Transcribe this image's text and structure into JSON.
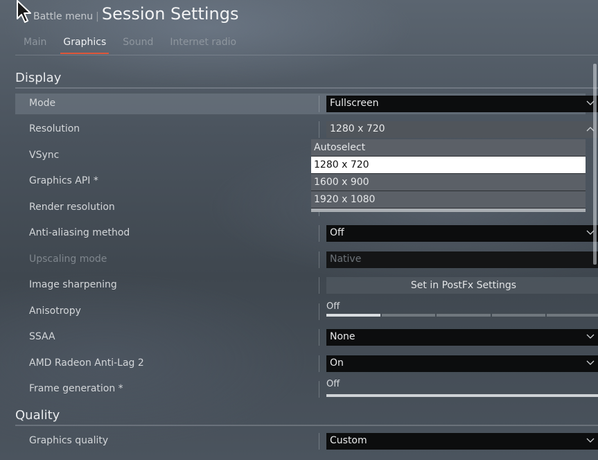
{
  "header": {
    "breadcrumb": "Battle menu",
    "separator": "|",
    "title": "Session Settings"
  },
  "tabs": [
    {
      "label": "Main",
      "active": false
    },
    {
      "label": "Graphics",
      "active": true
    },
    {
      "label": "Sound",
      "active": false
    },
    {
      "label": "Internet radio",
      "active": false
    }
  ],
  "sections": {
    "display": "Display",
    "quality": "Quality"
  },
  "settings": {
    "mode": {
      "label": "Mode",
      "value": "Fullscreen"
    },
    "resolution": {
      "label": "Resolution",
      "value": "1280 x 720",
      "options": [
        "Autoselect",
        "1280 x 720",
        "1600 x 900",
        "1920 x 1080"
      ],
      "selected_index": 1
    },
    "vsync": {
      "label": "VSync"
    },
    "graphics_api": {
      "label": "Graphics API *"
    },
    "render_resolution": {
      "label": "Render resolution"
    },
    "anti_aliasing": {
      "label": "Anti-aliasing method",
      "value": "Off"
    },
    "upscaling": {
      "label": "Upscaling mode",
      "value": "Native"
    },
    "image_sharpening": {
      "label": "Image sharpening",
      "button": "Set in PostFx Settings"
    },
    "anisotropy": {
      "label": "Anisotropy",
      "value": "Off",
      "level": 0.2
    },
    "ssaa": {
      "label": "SSAA",
      "value": "None"
    },
    "antilag": {
      "label": "AMD Radeon Anti-Lag 2",
      "value": "On"
    },
    "frame_generation": {
      "label": "Frame generation *",
      "value": "Off"
    },
    "graphics_quality": {
      "label": "Graphics quality",
      "value": "Custom"
    }
  },
  "colors": {
    "accent": "#e0573a",
    "control_bg": "#0c0d0e",
    "dropdown_selected": "#ffffff"
  }
}
